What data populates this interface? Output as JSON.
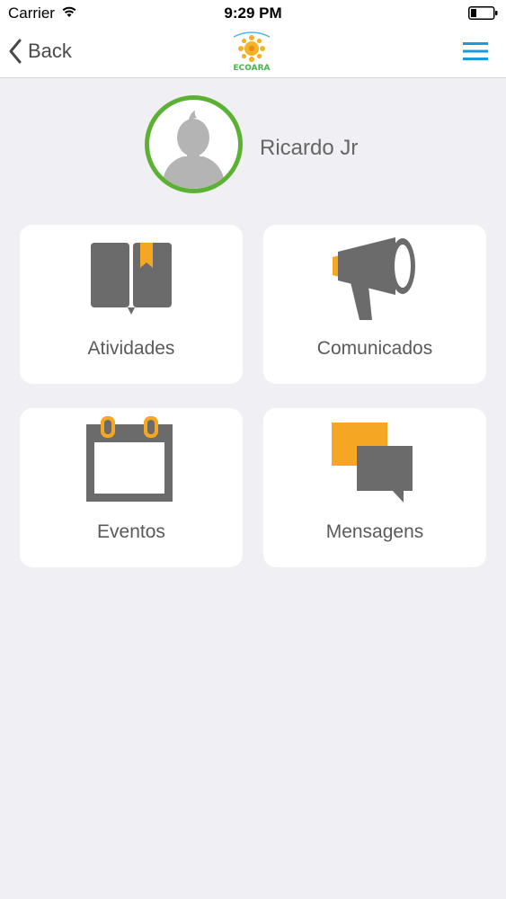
{
  "status_bar": {
    "carrier": "Carrier",
    "time": "9:29 PM"
  },
  "nav": {
    "back_label": "Back",
    "logo_text": "ECOARA"
  },
  "profile": {
    "name": "Ricardo Jr"
  },
  "tiles": [
    {
      "label": "Atividades",
      "icon": "book-icon"
    },
    {
      "label": "Comunicados",
      "icon": "megaphone-icon"
    },
    {
      "label": "Eventos",
      "icon": "calendar-icon"
    },
    {
      "label": "Mensagens",
      "icon": "chat-bubbles-icon"
    }
  ],
  "colors": {
    "accent_orange": "#f5a623",
    "icon_gray": "#6b6b6b",
    "avatar_ring": "#5bb132",
    "menu_blue": "#1e9bd7"
  }
}
